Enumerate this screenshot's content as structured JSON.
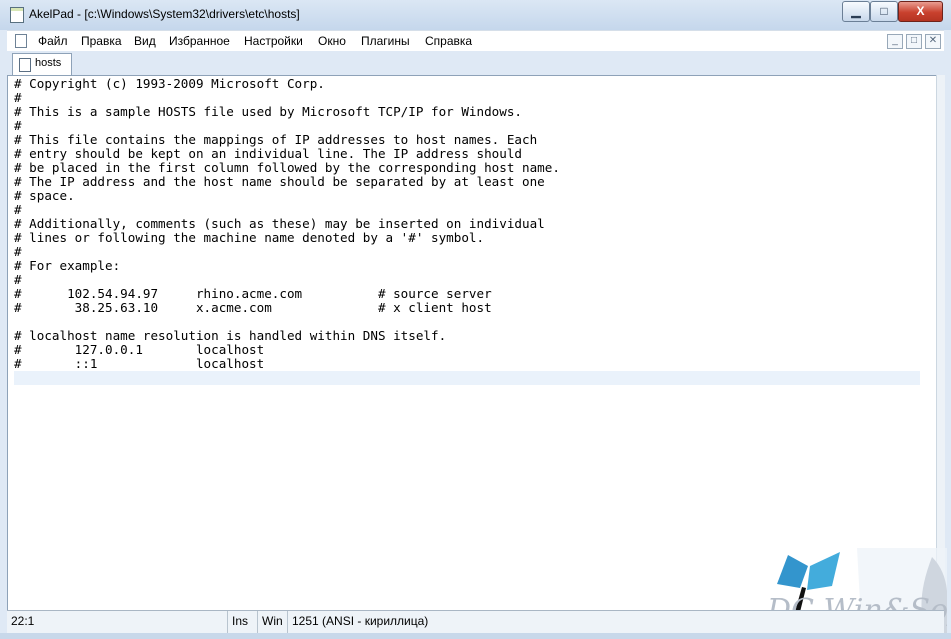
{
  "window": {
    "title": "AkelPad - [c:\\Windows\\System32\\drivers\\etc\\hosts]",
    "controls": {
      "minimize": "▁",
      "maximize": "□",
      "close": "X"
    }
  },
  "menu": {
    "items": [
      "Файл",
      "Правка",
      "Вид",
      "Избранное",
      "Настройки",
      "Окно",
      "Плагины",
      "Справка"
    ],
    "mdi_controls": [
      "_",
      "□",
      "✕"
    ]
  },
  "tabs": [
    {
      "label": "hosts",
      "active": true
    }
  ],
  "editor": {
    "lines": [
      "# Copyright (c) 1993-2009 Microsoft Corp.",
      "#",
      "# This is a sample HOSTS file used by Microsoft TCP/IP for Windows.",
      "#",
      "# This file contains the mappings of IP addresses to host names. Each",
      "# entry should be kept on an individual line. The IP address should",
      "# be placed in the first column followed by the corresponding host name.",
      "# The IP address and the host name should be separated by at least one",
      "# space.",
      "#",
      "# Additionally, comments (such as these) may be inserted on individual",
      "# lines or following the machine name denoted by a '#' symbol.",
      "#",
      "# For example:",
      "#",
      "#      102.54.94.97     rhino.acme.com          # source server",
      "#       38.25.63.10     x.acme.com              # x client host",
      "",
      "# localhost name resolution is handled within DNS itself.",
      "#       127.0.0.1       localhost",
      "#       ::1             localhost",
      ""
    ],
    "current_line_index": 21
  },
  "watermark": {
    "text": "DC Win&Soft"
  },
  "status": {
    "position": "22:1",
    "insert_mode": "Ins",
    "newline": "Win",
    "encoding": "1251  (ANSI - кириллица)"
  }
}
